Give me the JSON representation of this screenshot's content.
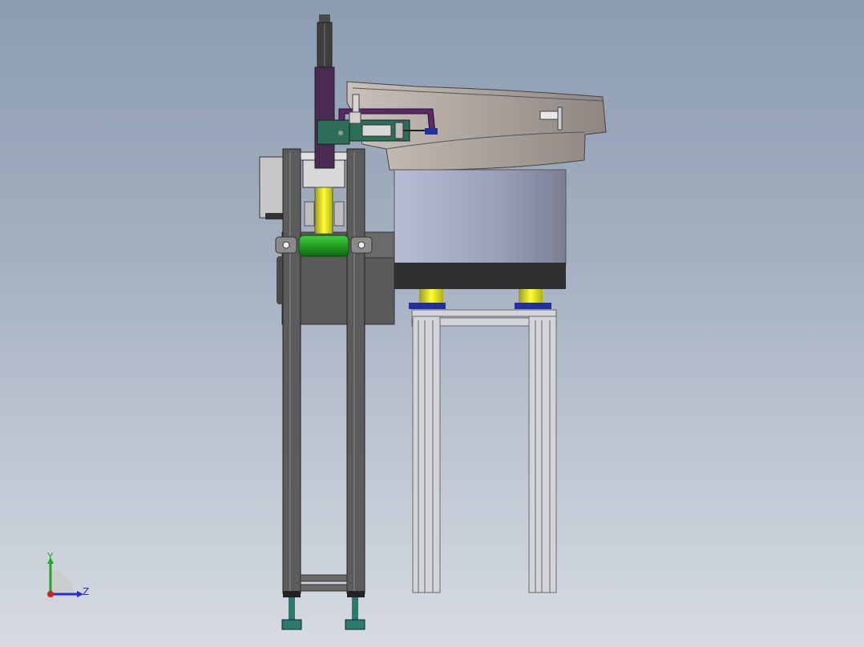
{
  "viewport": {
    "background_top": "#8d9cb1",
    "background_bottom": "#d6dbe2"
  },
  "model": {
    "parts": {
      "frame_color": "#5a5a5a",
      "bowl_color": "#9aa0b8",
      "rail_color": "#d2d4d8",
      "cylinder_color": "#e4e400",
      "roller_color": "#1aa01a",
      "arm_color": "#4a2a50",
      "foot_color": "#2b7a6e",
      "mount_color": "#2030a0"
    }
  },
  "triad": {
    "y_label": "Y",
    "z_label": "Z",
    "y_color": "#1fa81f",
    "z_color": "#2a2ad6",
    "x_color": "#d42020"
  }
}
